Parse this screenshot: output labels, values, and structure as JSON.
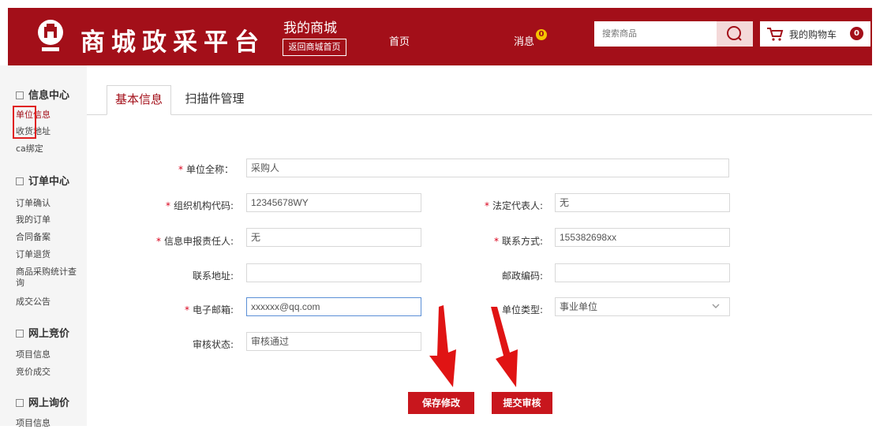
{
  "header": {
    "logo_text": "商城政采平台",
    "mall_title": "我的商城",
    "back_home": "返回商城首页",
    "nav_home": "首页",
    "nav_messages": "消息",
    "messages_count": "0",
    "search_placeholder": "搜索商品",
    "cart_label": "我的购物车",
    "cart_count": "0"
  },
  "sidebar": {
    "sections": [
      {
        "title": "信息中心",
        "items": [
          "单位信息",
          "收货地址",
          "ca绑定"
        ]
      },
      {
        "title": "订单中心",
        "items": [
          "订单确认",
          "我的订单",
          "合同备案",
          "订单退货",
          "商品采购统计查",
          "询",
          "成交公告"
        ]
      },
      {
        "title": "网上竞价",
        "items": [
          "项目信息",
          "竞价成交"
        ]
      },
      {
        "title": "网上询价",
        "items": [
          "项目信息"
        ]
      }
    ]
  },
  "tabs": [
    "基本信息",
    "扫描件管理"
  ],
  "form": {
    "unit_name_label": "单位全称：",
    "unit_name": "采购人",
    "org_code_label": "组织机构代码:",
    "org_code": "12345678WY",
    "legal_rep_label": "法定代表人:",
    "legal_rep": "无",
    "reporter_label": "信息申报责任人:",
    "reporter": "无",
    "contact_label": "联系方式:",
    "contact": "155382698xx",
    "address_label": "联系地址:",
    "address": "",
    "postcode_label": "邮政编码:",
    "postcode": "",
    "email_label": "电子邮箱:",
    "email": "xxxxxx@qq.com",
    "unit_type_label": "单位类型:",
    "unit_type": "事业单位",
    "audit_label": "审核状态:",
    "audit_status": "审核通过",
    "required_mark": "*"
  },
  "buttons": {
    "save": "保存修改",
    "submit": "提交审核"
  },
  "colors": {
    "brand": "#a30f19",
    "button": "#c8161d",
    "required": "#d9001b",
    "annotation": "#e02020"
  }
}
